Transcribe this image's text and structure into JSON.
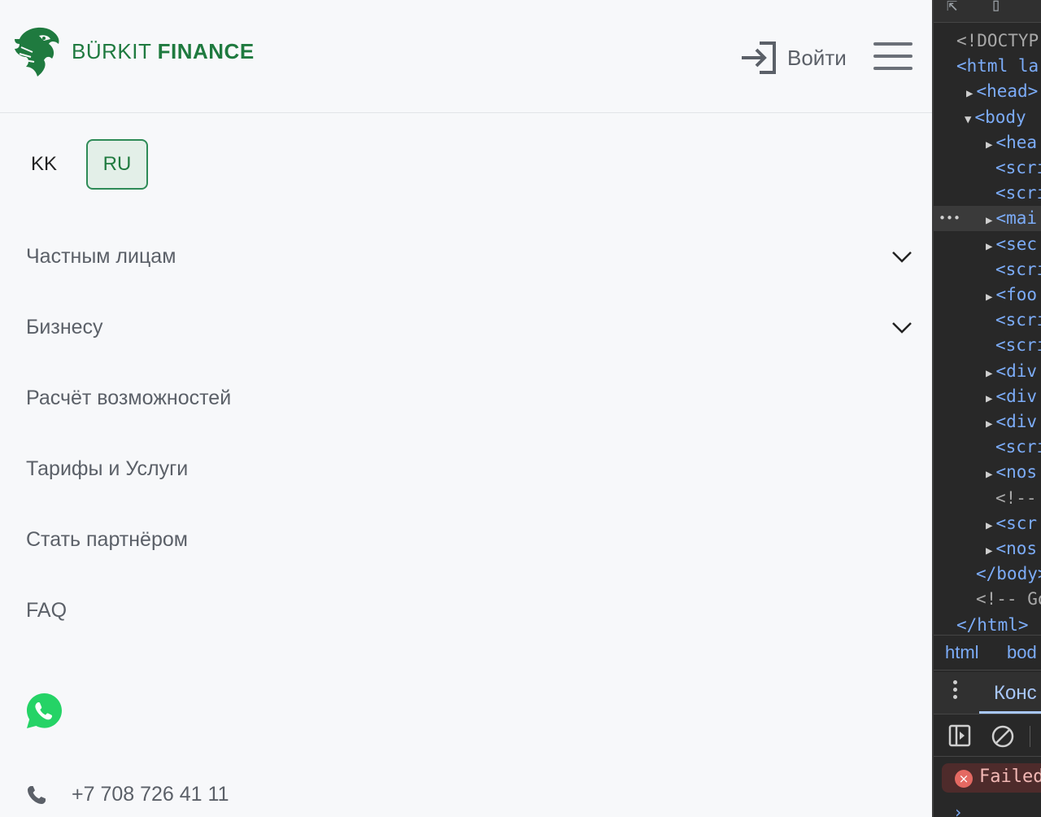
{
  "header": {
    "brand_thin": "BÜRKIT ",
    "brand_bold": "FINANCE",
    "login_label": "Войти"
  },
  "languages": [
    {
      "label": "KK",
      "active": false
    },
    {
      "label": "RU",
      "active": true
    }
  ],
  "menu": [
    {
      "label": "Частным лицам",
      "has_submenu": true
    },
    {
      "label": "Бизнесу",
      "has_submenu": true
    },
    {
      "label": "Расчёт возможностей",
      "has_submenu": false
    },
    {
      "label": "Тарифы и Услуги",
      "has_submenu": false
    },
    {
      "label": "Стать партнёром",
      "has_submenu": false
    },
    {
      "label": "FAQ",
      "has_submenu": false
    }
  ],
  "contacts": {
    "whatsapp_icon": "whatsapp-icon",
    "phone": "+7 708 726 41 11"
  },
  "devtools": {
    "dom_lines": [
      {
        "indent": 28,
        "tri": "",
        "text": "<!DOCTYP",
        "cls": "muted"
      },
      {
        "indent": 28,
        "tri": "",
        "text": "<html la",
        "cls": "tag"
      },
      {
        "indent": 40,
        "tri": "▶",
        "text": "<head>",
        "cls": "tag"
      },
      {
        "indent": 38,
        "tri": "▼",
        "text": "<body ",
        "cls": "tag"
      },
      {
        "indent": 64,
        "tri": "▶",
        "text": "<hea",
        "cls": "tag"
      },
      {
        "indent": 76,
        "tri": "",
        "text": "<scri",
        "cls": "tag"
      },
      {
        "indent": 76,
        "tri": "",
        "text": "<scri",
        "cls": "tag"
      },
      {
        "indent": 64,
        "tri": "▶",
        "text": "<mai",
        "cls": "tag",
        "highlight": true
      },
      {
        "indent": 64,
        "tri": "▶",
        "text": "<sec",
        "cls": "tag"
      },
      {
        "indent": 76,
        "tri": "",
        "text": "<scri",
        "cls": "tag"
      },
      {
        "indent": 64,
        "tri": "▶",
        "text": "<foo",
        "cls": "tag"
      },
      {
        "indent": 76,
        "tri": "",
        "text": "<scri",
        "cls": "tag"
      },
      {
        "indent": 76,
        "tri": "",
        "text": "<scri",
        "cls": "tag"
      },
      {
        "indent": 64,
        "tri": "▶",
        "text": "<div",
        "cls": "tag"
      },
      {
        "indent": 64,
        "tri": "▶",
        "text": "<div",
        "cls": "tag"
      },
      {
        "indent": 64,
        "tri": "▶",
        "text": "<div",
        "cls": "tag"
      },
      {
        "indent": 76,
        "tri": "",
        "text": "<scri",
        "cls": "tag"
      },
      {
        "indent": 64,
        "tri": "▶",
        "text": "<nos",
        "cls": "tag"
      },
      {
        "indent": 76,
        "tri": "",
        "text": "<!-- ",
        "cls": "muted"
      },
      {
        "indent": 64,
        "tri": "▶",
        "text": "<scr",
        "cls": "tag"
      },
      {
        "indent": 64,
        "tri": "▶",
        "text": "<nos",
        "cls": "tag"
      },
      {
        "indent": 52,
        "tri": "",
        "text": "</body>",
        "cls": "tag"
      },
      {
        "indent": 52,
        "tri": "",
        "text": "<!-- Go",
        "cls": "muted"
      },
      {
        "indent": 28,
        "tri": "",
        "text": "</html>",
        "cls": "tag"
      }
    ],
    "breadcrumb": [
      "html",
      "bod"
    ],
    "drawer_tab": "Конс",
    "error_text": "Failed",
    "highlight_marker": "•••",
    "prompt": "›"
  },
  "colors": {
    "brand_green": "#1f7a3f",
    "active_lang_bg": "#e3efe8",
    "active_lang_border": "#2e8b57",
    "menu_text": "#5b6068",
    "whatsapp_green": "#25d366",
    "devtools_bg": "#282828"
  }
}
